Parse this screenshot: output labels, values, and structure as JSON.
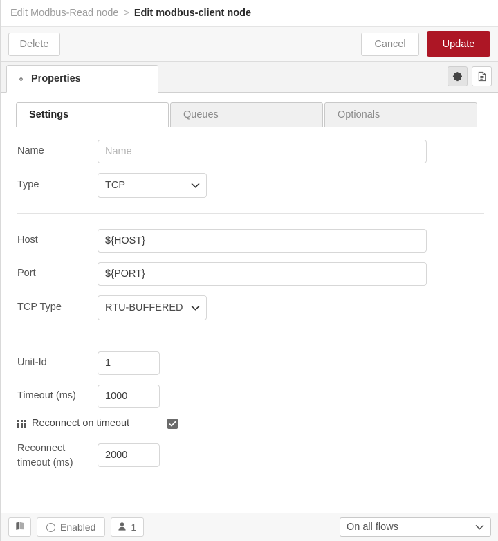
{
  "breadcrumb": {
    "previous": "Edit Modbus-Read node",
    "separator": ">",
    "current": "Edit modbus-client node"
  },
  "toolbar": {
    "delete_label": "Delete",
    "cancel_label": "Cancel",
    "update_label": "Update",
    "update_color": "#ad1625"
  },
  "outer_tabs": {
    "properties_label": "Properties",
    "settings_icon": "gear-icon",
    "description_icon": "document-icon"
  },
  "inner_tabs": [
    {
      "label": "Settings",
      "active": true
    },
    {
      "label": "Queues",
      "active": false
    },
    {
      "label": "Optionals",
      "active": false
    }
  ],
  "form": {
    "name": {
      "label": "Name",
      "value": "",
      "placeholder": "Name"
    },
    "type": {
      "label": "Type",
      "value": "TCP"
    },
    "host": {
      "label": "Host",
      "value": "${HOST}"
    },
    "port": {
      "label": "Port",
      "value": "${PORT}"
    },
    "tcp_type": {
      "label": "TCP Type",
      "value": "RTU-BUFFERED"
    },
    "unit_id": {
      "label": "Unit-Id",
      "value": "1"
    },
    "timeout": {
      "label": "Timeout (ms)",
      "value": "1000"
    },
    "reconnect_on_timeout": {
      "label": "Reconnect on timeout",
      "icon": "grid-icon",
      "checked": true
    },
    "reconnect_timeout": {
      "label": "Reconnect\ntimeout (ms)",
      "value": "2000"
    }
  },
  "footer": {
    "docs_icon": "book-icon",
    "enabled_label": "Enabled",
    "enabled_icon": "circle-icon",
    "users_icon": "user-icon",
    "users_count": "1",
    "scope_value": "On all flows"
  }
}
